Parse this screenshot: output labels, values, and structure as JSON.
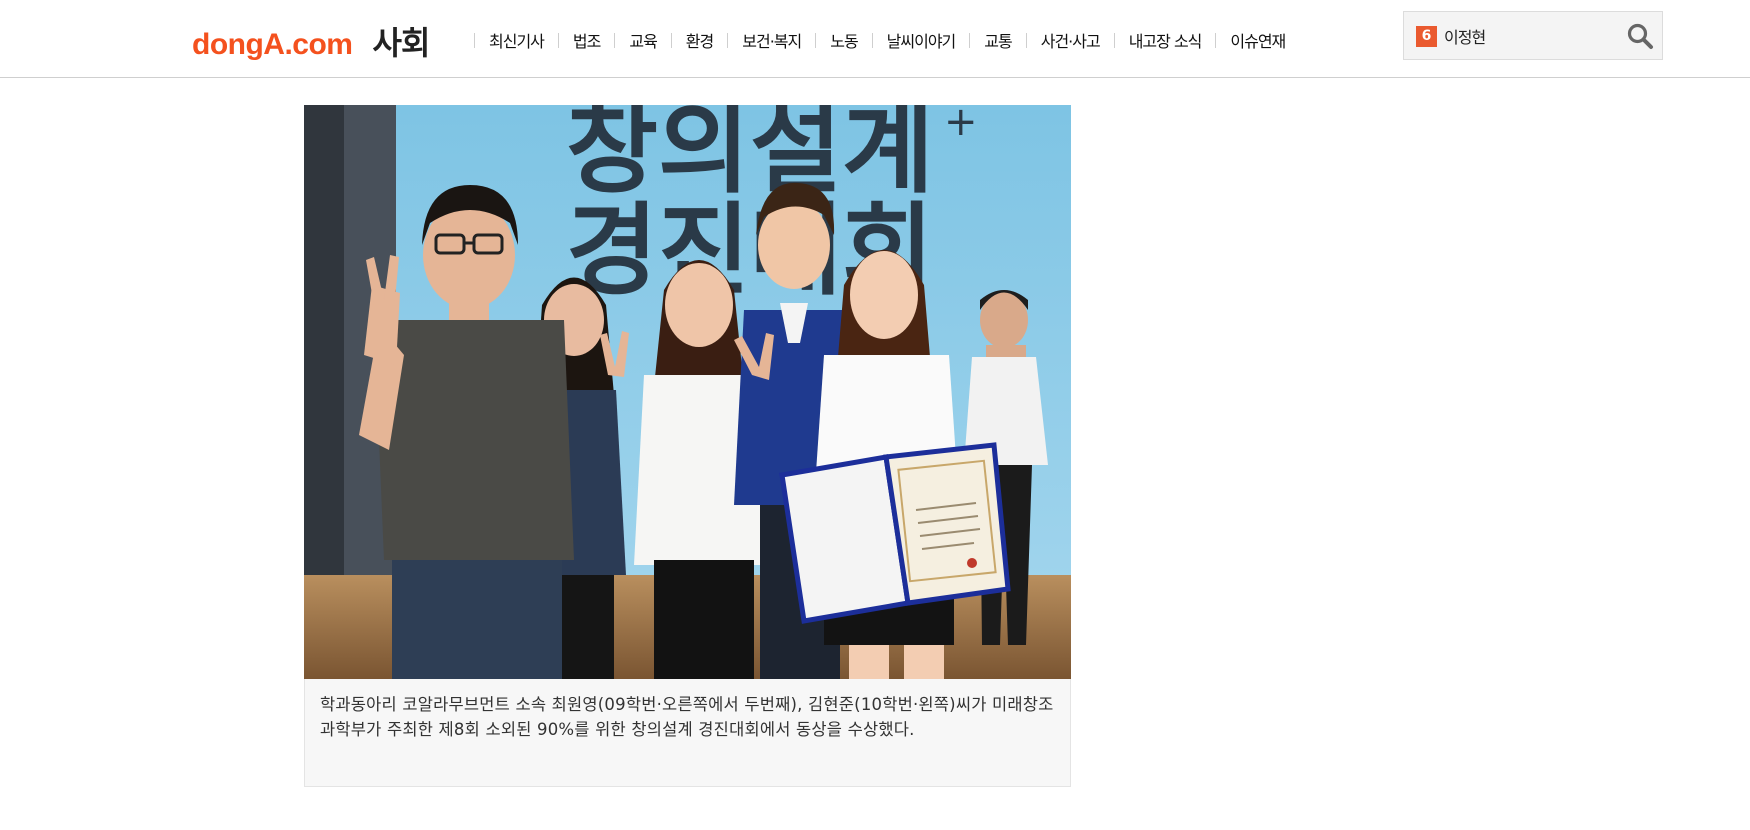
{
  "header": {
    "logo_brand": "dongA.com",
    "section_title": "사회",
    "nav_items": [
      {
        "label": "최신기사"
      },
      {
        "label": "법조"
      },
      {
        "label": "교육"
      },
      {
        "label": "환경"
      },
      {
        "label": "보건·복지"
      },
      {
        "label": "노동"
      },
      {
        "label": "날씨이야기"
      },
      {
        "label": "교통"
      },
      {
        "label": "사건·사고"
      },
      {
        "label": "내고장 소식"
      },
      {
        "label": "이슈연재"
      }
    ],
    "search": {
      "rank": "6",
      "value": "이정현"
    }
  },
  "article": {
    "photo_banner_text": [
      "창의설계",
      "경진대회"
    ],
    "caption": "학과동아리 코알라무브먼트 소속 최원영(09학번·오른쪽에서 두번째), 김현준(10학번·왼쪽)씨가 미래창조과학부가 주최한 제8회 소외된 90%를 위한 창의설계 경진대회에서 동상을 수상했다."
  },
  "colors": {
    "brand": "#f4511e",
    "rank_badge": "#ea5a2f"
  },
  "icons": {
    "search": "search-icon"
  }
}
